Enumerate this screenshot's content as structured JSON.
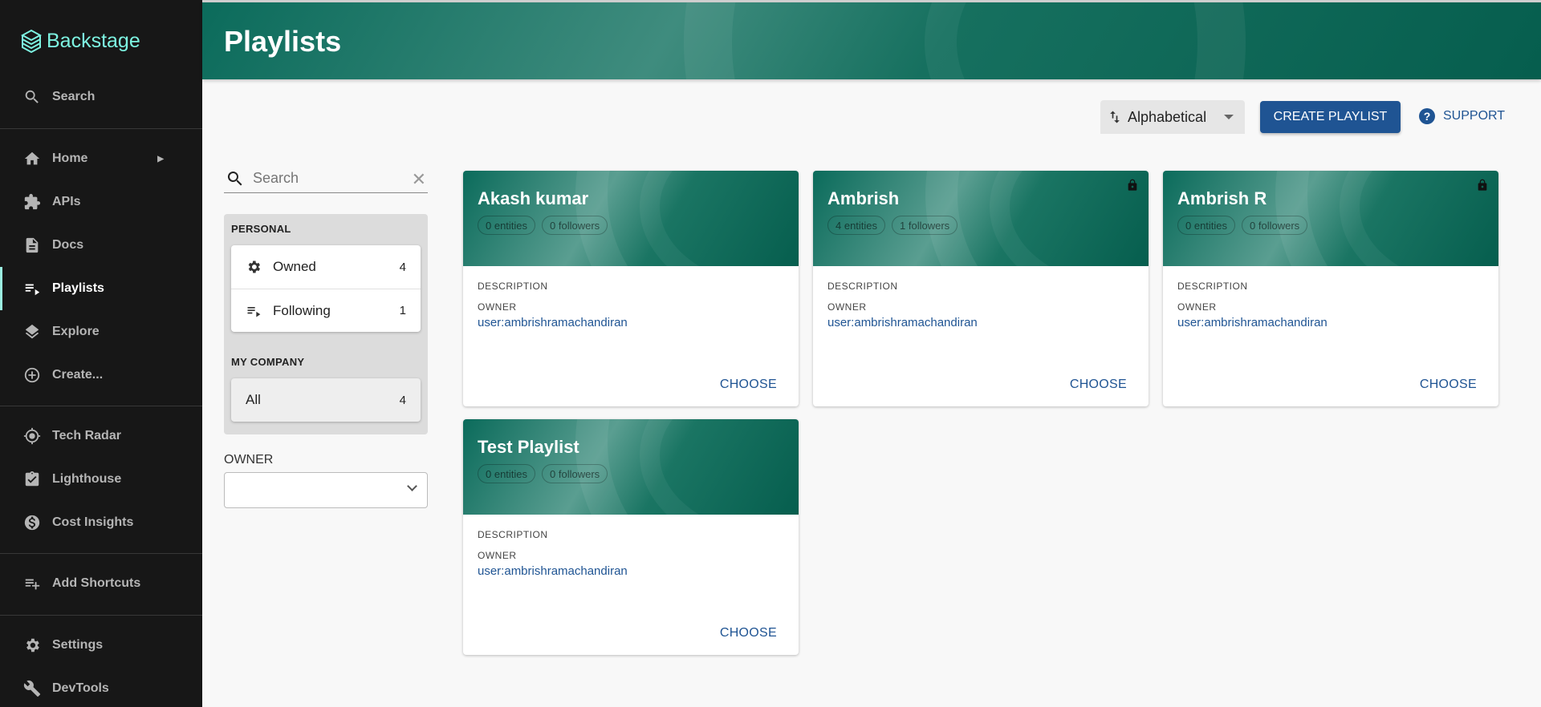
{
  "app": {
    "name": "Backstage"
  },
  "sidebar": {
    "search_label": "Search",
    "items": [
      {
        "label": "Home",
        "icon": "home-icon"
      },
      {
        "label": "APIs",
        "icon": "puzzle-icon"
      },
      {
        "label": "Docs",
        "icon": "doc-icon"
      },
      {
        "label": "Playlists",
        "icon": "playlist-icon",
        "active": true
      },
      {
        "label": "Explore",
        "icon": "layers-icon"
      },
      {
        "label": "Create...",
        "icon": "add-circle-icon"
      },
      {
        "label": "Tech Radar",
        "icon": "radar-icon"
      },
      {
        "label": "Lighthouse",
        "icon": "clipboard-check-icon"
      },
      {
        "label": "Cost Insights",
        "icon": "money-icon"
      },
      {
        "label": "Add Shortcuts",
        "icon": "playlist-add-icon"
      },
      {
        "label": "Settings",
        "icon": "gear-icon"
      },
      {
        "label": "DevTools",
        "icon": "wrench-icon"
      }
    ]
  },
  "header": {
    "title": "Playlists"
  },
  "toolbar": {
    "sort_value": "Alphabetical",
    "create_label": "CREATE PLAYLIST",
    "support_label": "SUPPORT"
  },
  "filters": {
    "search_placeholder": "Search",
    "personal_title": "PERSONAL",
    "owned_label": "Owned",
    "owned_count": "4",
    "following_label": "Following",
    "following_count": "1",
    "company_title": "MY COMPANY",
    "all_label": "All",
    "all_count": "4",
    "owner_label": "OWNER"
  },
  "cards": [
    {
      "title": "Akash kumar",
      "entities": "0 entities",
      "followers": "0 followers",
      "locked": false,
      "description_label": "DESCRIPTION",
      "owner_label": "OWNER",
      "owner": "user:ambrishramachandiran",
      "choose": "CHOOSE"
    },
    {
      "title": "Ambrish",
      "entities": "4 entities",
      "followers": "1 followers",
      "locked": true,
      "description_label": "DESCRIPTION",
      "owner_label": "OWNER",
      "owner": "user:ambrishramachandiran",
      "choose": "CHOOSE"
    },
    {
      "title": "Ambrish R",
      "entities": "0 entities",
      "followers": "0 followers",
      "locked": true,
      "description_label": "DESCRIPTION",
      "owner_label": "OWNER",
      "owner": "user:ambrishramachandiran",
      "choose": "CHOOSE"
    },
    {
      "title": "Test Playlist",
      "entities": "0 entities",
      "followers": "0 followers",
      "locked": false,
      "description_label": "DESCRIPTION",
      "owner_label": "OWNER",
      "owner": "user:ambrishramachandiran",
      "choose": "CHOOSE"
    }
  ]
}
